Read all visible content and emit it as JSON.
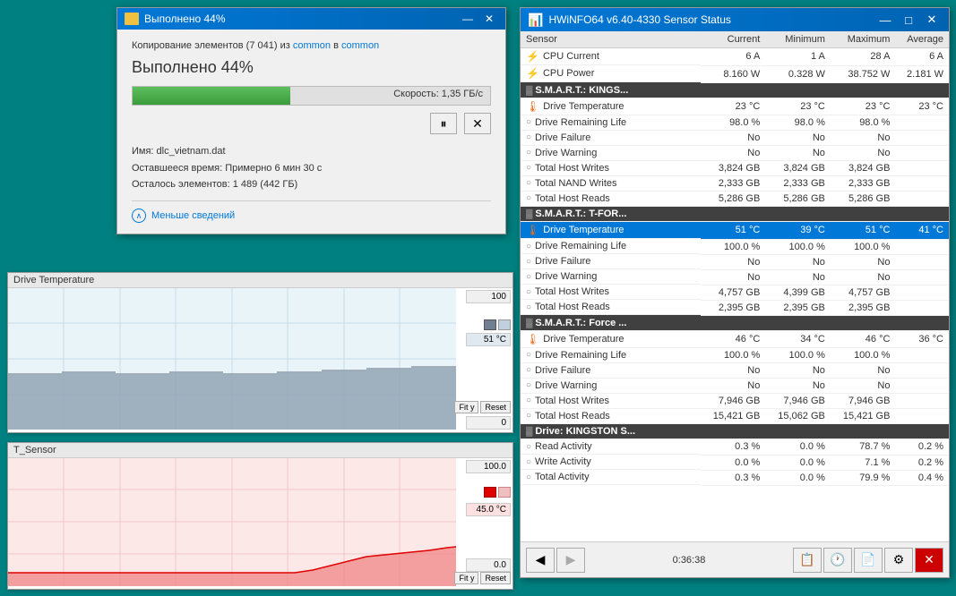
{
  "copyDialog": {
    "title": "Выполнено 44%",
    "copyLine": "Копирование элементов (7 041) из common в common",
    "progressLabel": "Выполнено 44%",
    "progressPercent": 44,
    "speedLabel": "Скорость: 1,35 ГБ/с",
    "fileName": "dlc_vietnam.dat",
    "fileNameLabel": "Имя:",
    "timeLeft": "Примерно 6 мин 30 с",
    "timeLeftLabel": "Оставшееся время:",
    "itemsLeft": "1 489 (442 ГБ)",
    "itemsLeftLabel": "Осталось элементов:",
    "detailsToggle": "Меньше сведений",
    "common1": "common",
    "common2": "common"
  },
  "graphPanel1": {
    "title": "Drive Temperature",
    "maxValue": "100",
    "currentValue": "51 °C",
    "minValue": "0",
    "fitBtn": "Fit y",
    "resetBtn": "Reset"
  },
  "graphPanel2": {
    "title": "T_Sensor",
    "maxValue": "100.0",
    "currentValue": "45.0 °C",
    "minValue": "0.0",
    "fitBtn": "Fit y",
    "resetBtn": "Reset"
  },
  "sensorWindow": {
    "title": "HWiNFO64 v6.40-4330 Sensor Status",
    "columns": {
      "sensor": "Sensor",
      "current": "Current",
      "minimum": "Minimum",
      "maximum": "Maximum",
      "average": "Average"
    },
    "sections": [
      {
        "header": null,
        "rows": [
          {
            "icon": "cpu",
            "name": "CPU Current",
            "current": "6 A",
            "minimum": "1 A",
            "maximum": "28 A",
            "average": "6 A",
            "highlighted": false
          },
          {
            "icon": "cpu",
            "name": "CPU Power",
            "current": "8.160 W",
            "minimum": "0.328 W",
            "maximum": "38.752 W",
            "average": "2.181 W",
            "highlighted": false
          }
        ]
      },
      {
        "header": "S.M.A.R.T.: KINGS...",
        "rows": [
          {
            "icon": "temp",
            "name": "Drive Temperature",
            "current": "23 °C",
            "minimum": "23 °C",
            "maximum": "23 °C",
            "average": "23 °C",
            "highlighted": false
          },
          {
            "icon": "circle",
            "name": "Drive Remaining Life",
            "current": "98.0 %",
            "minimum": "98.0 %",
            "maximum": "98.0 %",
            "average": "",
            "highlighted": false
          },
          {
            "icon": "circle",
            "name": "Drive Failure",
            "current": "No",
            "minimum": "No",
            "maximum": "No",
            "average": "",
            "highlighted": false
          },
          {
            "icon": "circle",
            "name": "Drive Warning",
            "current": "No",
            "minimum": "No",
            "maximum": "No",
            "average": "",
            "highlighted": false
          },
          {
            "icon": "circle",
            "name": "Total Host Writes",
            "current": "3,824 GB",
            "minimum": "3,824 GB",
            "maximum": "3,824 GB",
            "average": "",
            "highlighted": false
          },
          {
            "icon": "circle",
            "name": "Total NAND Writes",
            "current": "2,333 GB",
            "minimum": "2,333 GB",
            "maximum": "2,333 GB",
            "average": "",
            "highlighted": false
          },
          {
            "icon": "circle",
            "name": "Total Host Reads",
            "current": "5,286 GB",
            "minimum": "5,286 GB",
            "maximum": "5,286 GB",
            "average": "",
            "highlighted": false
          }
        ]
      },
      {
        "header": "S.M.A.R.T.: T-FOR...",
        "rows": [
          {
            "icon": "temp",
            "name": "Drive Temperature",
            "current": "51 °C",
            "minimum": "39 °C",
            "maximum": "51 °C",
            "average": "41 °C",
            "highlighted": true
          },
          {
            "icon": "circle",
            "name": "Drive Remaining Life",
            "current": "100.0 %",
            "minimum": "100.0 %",
            "maximum": "100.0 %",
            "average": "",
            "highlighted": false
          },
          {
            "icon": "circle",
            "name": "Drive Failure",
            "current": "No",
            "minimum": "No",
            "maximum": "No",
            "average": "",
            "highlighted": false
          },
          {
            "icon": "circle",
            "name": "Drive Warning",
            "current": "No",
            "minimum": "No",
            "maximum": "No",
            "average": "",
            "highlighted": false
          },
          {
            "icon": "circle",
            "name": "Total Host Writes",
            "current": "4,757 GB",
            "minimum": "4,399 GB",
            "maximum": "4,757 GB",
            "average": "",
            "highlighted": false
          },
          {
            "icon": "circle",
            "name": "Total Host Reads",
            "current": "2,395 GB",
            "minimum": "2,395 GB",
            "maximum": "2,395 GB",
            "average": "",
            "highlighted": false
          }
        ]
      },
      {
        "header": "S.M.A.R.T.: Force ...",
        "rows": [
          {
            "icon": "temp",
            "name": "Drive Temperature",
            "current": "46 °C",
            "minimum": "34 °C",
            "maximum": "46 °C",
            "average": "36 °C",
            "highlighted": false
          },
          {
            "icon": "circle",
            "name": "Drive Remaining Life",
            "current": "100.0 %",
            "minimum": "100.0 %",
            "maximum": "100.0 %",
            "average": "",
            "highlighted": false
          },
          {
            "icon": "circle",
            "name": "Drive Failure",
            "current": "No",
            "minimum": "No",
            "maximum": "No",
            "average": "",
            "highlighted": false
          },
          {
            "icon": "circle",
            "name": "Drive Warning",
            "current": "No",
            "minimum": "No",
            "maximum": "No",
            "average": "",
            "highlighted": false
          },
          {
            "icon": "circle",
            "name": "Total Host Writes",
            "current": "7,946 GB",
            "minimum": "7,946 GB",
            "maximum": "7,946 GB",
            "average": "",
            "highlighted": false
          },
          {
            "icon": "circle",
            "name": "Total Host Reads",
            "current": "15,421 GB",
            "minimum": "15,062 GB",
            "maximum": "15,421 GB",
            "average": "",
            "highlighted": false
          }
        ]
      },
      {
        "header": "Drive: KINGSTON S...",
        "rows": [
          {
            "icon": "circle",
            "name": "Read Activity",
            "current": "0.3 %",
            "minimum": "0.0 %",
            "maximum": "78.7 %",
            "average": "0.2 %",
            "highlighted": false
          },
          {
            "icon": "circle",
            "name": "Write Activity",
            "current": "0.0 %",
            "minimum": "0.0 %",
            "maximum": "7.1 %",
            "average": "0.2 %",
            "highlighted": false
          },
          {
            "icon": "circle",
            "name": "Total Activity",
            "current": "0.3 %",
            "minimum": "0.0 %",
            "maximum": "79.9 %",
            "average": "0.4 %",
            "highlighted": false
          }
        ]
      }
    ],
    "toolbar": {
      "prevBtn": "◀",
      "nextBtn": "▶",
      "time": "0:36:38",
      "btn1": "📋",
      "btn2": "🕐",
      "btn3": "📄",
      "btn4": "⚙",
      "closeBtn": "✕"
    }
  }
}
